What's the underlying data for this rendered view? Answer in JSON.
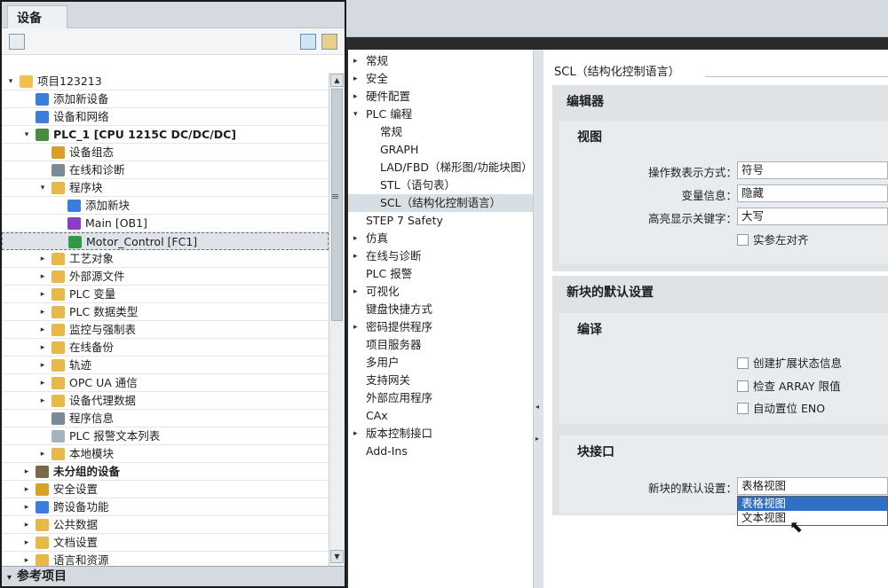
{
  "left_panel": {
    "tab": "设备",
    "bottom_title": "参考项目",
    "tree": [
      {
        "label": "项目123213",
        "arrow": "▾",
        "icon": "project-icon",
        "color": "#f0c14b",
        "bold": false
      },
      {
        "label": "添加新设备",
        "arrow": "",
        "icon": "add-device-icon",
        "color": "#3b7dd8",
        "bold": false
      },
      {
        "label": "设备和网络",
        "arrow": "",
        "icon": "network-icon",
        "color": "#3b7dd8",
        "bold": false
      },
      {
        "label": "PLC_1 [CPU 1215C DC/DC/DC]",
        "arrow": "▾",
        "icon": "plc-icon",
        "color": "#4a8c3f",
        "bold": true
      },
      {
        "label": "设备组态",
        "arrow": "",
        "icon": "device-config-icon",
        "color": "#d8a028",
        "bold": false
      },
      {
        "label": "在线和诊断",
        "arrow": "",
        "icon": "online-diagnostics-icon",
        "color": "#7a8a99",
        "bold": false
      },
      {
        "label": "程序块",
        "arrow": "▾",
        "icon": "folder-icon",
        "color": "#e7b84a",
        "bold": false
      },
      {
        "label": "添加新块",
        "arrow": "",
        "icon": "add-block-icon",
        "color": "#3b7dd8",
        "bold": false
      },
      {
        "label": "Main [OB1]",
        "arrow": "",
        "icon": "ob-block-icon",
        "color": "#8a3fc8",
        "bold": false
      },
      {
        "label": "Motor_Control [FC1]",
        "arrow": "",
        "icon": "fc-block-icon",
        "color": "#2f9a46",
        "bold": false,
        "selected": true
      },
      {
        "label": "工艺对象",
        "arrow": "▸",
        "icon": "folder-icon",
        "color": "#e7b84a",
        "bold": false
      },
      {
        "label": "外部源文件",
        "arrow": "▸",
        "icon": "folder-icon",
        "color": "#e7b84a",
        "bold": false
      },
      {
        "label": "PLC 变量",
        "arrow": "▸",
        "icon": "folder-icon",
        "color": "#e7b84a",
        "bold": false
      },
      {
        "label": "PLC 数据类型",
        "arrow": "▸",
        "icon": "folder-icon",
        "color": "#e7b84a",
        "bold": false
      },
      {
        "label": "监控与强制表",
        "arrow": "▸",
        "icon": "folder-icon",
        "color": "#e7b84a",
        "bold": false
      },
      {
        "label": "在线备份",
        "arrow": "▸",
        "icon": "folder-icon",
        "color": "#e7b84a",
        "bold": false
      },
      {
        "label": "轨迹",
        "arrow": "▸",
        "icon": "folder-icon",
        "color": "#e7b84a",
        "bold": false
      },
      {
        "label": "OPC UA 通信",
        "arrow": "▸",
        "icon": "folder-icon",
        "color": "#e7b84a",
        "bold": false
      },
      {
        "label": "设备代理数据",
        "arrow": "▸",
        "icon": "folder-icon",
        "color": "#e7b84a",
        "bold": false
      },
      {
        "label": "程序信息",
        "arrow": "",
        "icon": "program-info-icon",
        "color": "#7a8a99",
        "bold": false
      },
      {
        "label": "PLC 报警文本列表",
        "arrow": "",
        "icon": "alarm-text-icon",
        "color": "#a6b2bd",
        "bold": false
      },
      {
        "label": "本地模块",
        "arrow": "▸",
        "icon": "folder-icon",
        "color": "#e7b84a",
        "bold": false
      },
      {
        "label": "未分组的设备",
        "arrow": "▸",
        "icon": "ungrouped-devices-icon",
        "color": "#7a6a4a",
        "bold": true
      },
      {
        "label": "安全设置",
        "arrow": "▸",
        "icon": "security-icon",
        "color": "#d8a028",
        "bold": false
      },
      {
        "label": "跨设备功能",
        "arrow": "▸",
        "icon": "cross-device-icon",
        "color": "#3b7dd8",
        "bold": false
      },
      {
        "label": "公共数据",
        "arrow": "▸",
        "icon": "folder-icon",
        "color": "#e7b84a",
        "bold": false
      },
      {
        "label": "文档设置",
        "arrow": "▸",
        "icon": "folder-icon",
        "color": "#e7b84a",
        "bold": false
      },
      {
        "label": "语言和资源",
        "arrow": "▸",
        "icon": "folder-icon",
        "color": "#e7b84a",
        "bold": false
      }
    ]
  },
  "nav": {
    "items": [
      {
        "label": "常规",
        "arrow": "▸",
        "level": 0
      },
      {
        "label": "安全",
        "arrow": "▸",
        "level": 0
      },
      {
        "label": "硬件配置",
        "arrow": "▸",
        "level": 0
      },
      {
        "label": "PLC 编程",
        "arrow": "▾",
        "level": 0
      },
      {
        "label": "常规",
        "arrow": "",
        "level": 2
      },
      {
        "label": "GRAPH",
        "arrow": "",
        "level": 2
      },
      {
        "label": "LAD/FBD（梯形图/功能块图）",
        "arrow": "",
        "level": 2
      },
      {
        "label": "STL（语句表）",
        "arrow": "",
        "level": 2
      },
      {
        "label": "SCL（结构化控制语言）",
        "arrow": "",
        "level": 2,
        "selected": true
      },
      {
        "label": "STEP 7 Safety",
        "arrow": "",
        "level": 1
      },
      {
        "label": "仿真",
        "arrow": "▸",
        "level": 0
      },
      {
        "label": "在线与诊断",
        "arrow": "▸",
        "level": 0
      },
      {
        "label": "PLC 报警",
        "arrow": "",
        "level": 1
      },
      {
        "label": "可视化",
        "arrow": "▸",
        "level": 0
      },
      {
        "label": "键盘快捷方式",
        "arrow": "",
        "level": 1
      },
      {
        "label": "密码提供程序",
        "arrow": "▸",
        "level": 0
      },
      {
        "label": "项目服务器",
        "arrow": "",
        "level": 1
      },
      {
        "label": "多用户",
        "arrow": "",
        "level": 1
      },
      {
        "label": "支持网关",
        "arrow": "",
        "level": 1
      },
      {
        "label": "外部应用程序",
        "arrow": "",
        "level": 1
      },
      {
        "label": "CAx",
        "arrow": "",
        "level": 1
      },
      {
        "label": "版本控制接口",
        "arrow": "▸",
        "level": 0
      },
      {
        "label": "Add-Ins",
        "arrow": "",
        "level": 1
      }
    ]
  },
  "content": {
    "page_title": "SCL（结构化控制语言）",
    "editor": {
      "title": "编辑器",
      "view_title": "视图",
      "operand_label": "操作数表示方式：",
      "operand_value": "符号",
      "varinfo_label": "变量信息：",
      "varinfo_value": "隐藏",
      "highlight_label": "高亮显示关键字：",
      "highlight_value": "大写",
      "indent_label": "实参左对齐"
    },
    "defaults": {
      "title": "新块的默认设置",
      "compile_title": "编译",
      "cb1": "创建扩展状态信息",
      "cb2": "检查 ARRAY 限值",
      "cb3": "自动置位 ENO",
      "interface_title": "块接口",
      "iface_label": "新块的默认设置：",
      "iface_value": "表格视图",
      "options": [
        "表格视图",
        "文本视图"
      ]
    }
  }
}
